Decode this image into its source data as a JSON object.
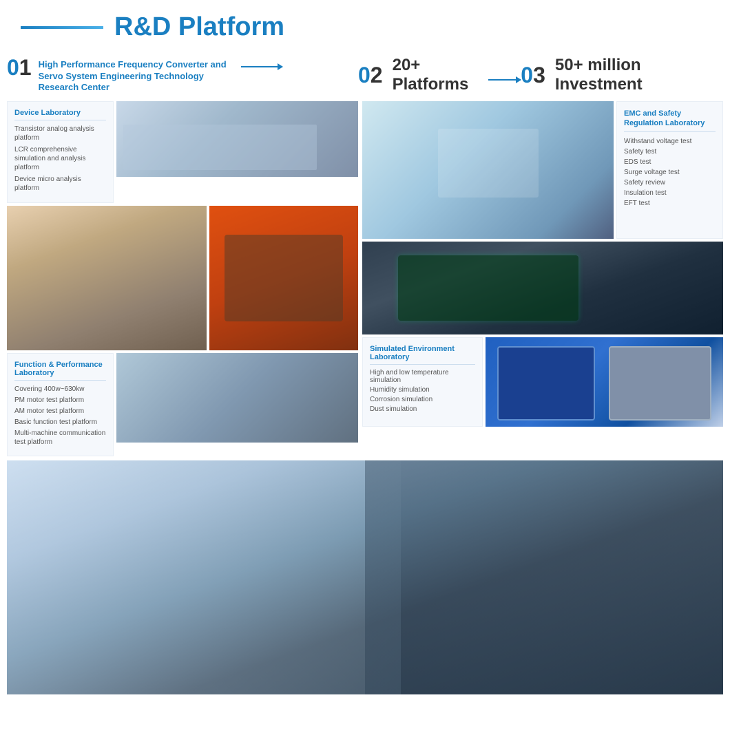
{
  "header": {
    "title": "R&D Platform",
    "line_color": "#1a7fc1"
  },
  "sections": {
    "s1": {
      "num": "01",
      "text": "High Performance Frequency Converter and Servo System Engineering Technology Research Center"
    },
    "s2": {
      "num": "02",
      "text": "20+ Platforms"
    },
    "s3": {
      "num": "03",
      "text": "50+ million Investment"
    }
  },
  "device_lab": {
    "title": "Device Laboratory",
    "items": [
      "Transistor analog analysis platform",
      "LCR comprehensive simulation and analysis platform",
      "Device micro analysis platform"
    ]
  },
  "emc_lab": {
    "title": "EMC and Safety Regulation Laboratory",
    "items": [
      "Withstand voltage test",
      "Safety test",
      "EDS test",
      "Surge voltage test",
      "Safety review",
      "Insulation test",
      "EFT test"
    ]
  },
  "func_lab": {
    "title": "Function & Performance Laboratory",
    "items": [
      "Covering 400w~630kw",
      "PM motor test platform",
      "AM motor test platform",
      "Basic function test platform",
      "Multi-machine communication test platform"
    ]
  },
  "sim_env_lab": {
    "title": "Simulated Environment Laboratory",
    "items": [
      "High and low temperature simulation",
      "Humidity simulation",
      "Corrosion simulation",
      "Dust simulation"
    ]
  }
}
